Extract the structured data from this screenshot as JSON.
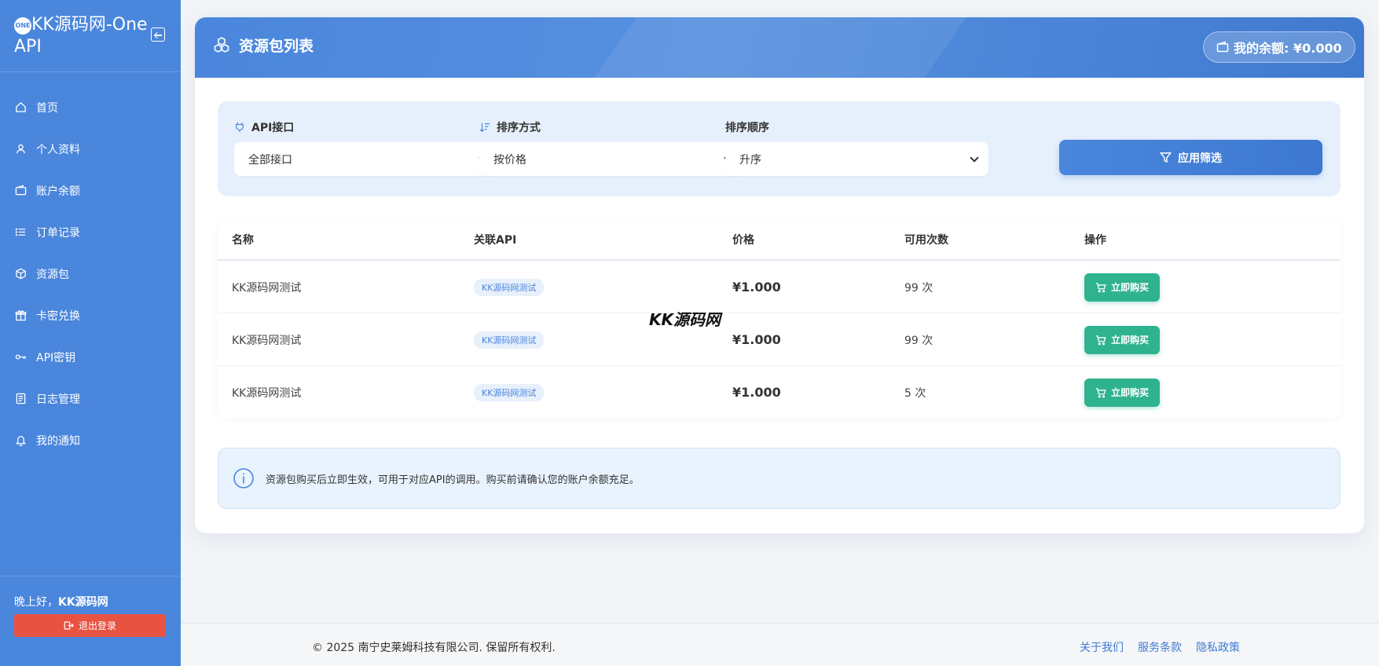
{
  "brand": {
    "logo_text": "ONE",
    "title": "KK源码网-One API"
  },
  "nav": [
    {
      "label": "首页",
      "icon": "home-icon"
    },
    {
      "label": "个人资料",
      "icon": "user-icon"
    },
    {
      "label": "账户余额",
      "icon": "wallet-icon"
    },
    {
      "label": "订单记录",
      "icon": "list-icon"
    },
    {
      "label": "资源包",
      "icon": "box-icon"
    },
    {
      "label": "卡密兑换",
      "icon": "gift-icon"
    },
    {
      "label": "API密钥",
      "icon": "key-icon"
    },
    {
      "label": "日志管理",
      "icon": "log-icon"
    },
    {
      "label": "我的通知",
      "icon": "bell-icon"
    }
  ],
  "user": {
    "greeting_prefix": "晚上好，",
    "name": "KK源码网",
    "logout_label": "退出登录"
  },
  "header": {
    "title": "资源包列表",
    "balance": "我的余额: ¥0.000"
  },
  "filters": {
    "api": {
      "label": "API接口",
      "value": "全部接口"
    },
    "sort_by": {
      "label": "排序方式",
      "value": "按价格"
    },
    "order": {
      "label": "排序顺序",
      "value": "升序"
    },
    "apply_label": "应用筛选"
  },
  "table": {
    "columns": [
      "名称",
      "关联API",
      "价格",
      "可用次数",
      "操作"
    ],
    "rows": [
      {
        "name": "KK源码网测试",
        "api": "KK源码网测试",
        "price": "¥1.000",
        "count": "99 次",
        "action": "立即购买"
      },
      {
        "name": "KK源码网测试",
        "api": "KK源码网测试",
        "price": "¥1.000",
        "count": "99 次",
        "action": "立即购买"
      },
      {
        "name": "KK源码网测试",
        "api": "KK源码网测试",
        "price": "¥1.000",
        "count": "5 次",
        "action": "立即购买"
      }
    ]
  },
  "info_text": "资源包购买后立即生效，可用于对应API的调用。购买前请确认您的账户余额充足。",
  "watermark": "KK源码网",
  "footer": {
    "copyright": "© 2025 南宁史莱姆科技有限公司. 保留所有权利.",
    "links": [
      "关于我们",
      "服务条款",
      "隐私政策"
    ]
  },
  "colors": {
    "primary": "#4a86dc",
    "success": "#2fb38f",
    "danger": "#e85241"
  }
}
